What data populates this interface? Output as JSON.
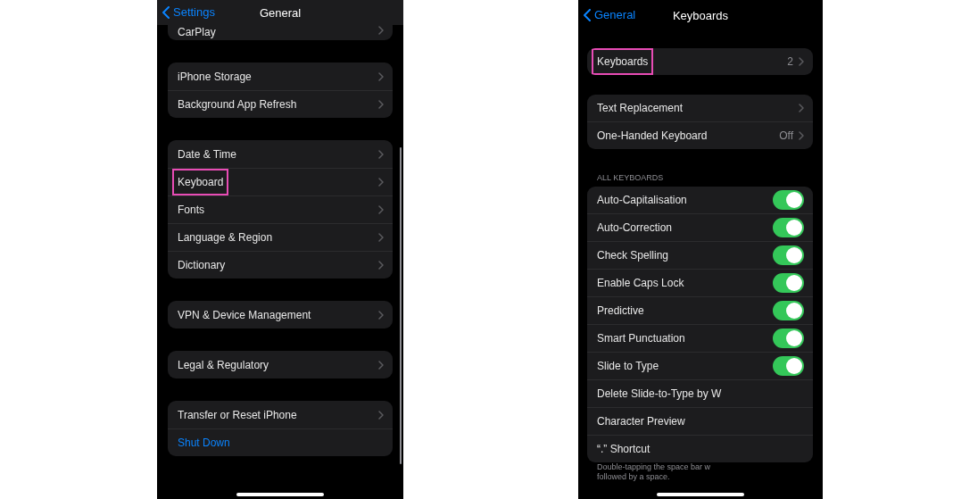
{
  "screens": [
    {
      "back": "Settings",
      "title": "General",
      "groups": [
        {
          "rows": [
            {
              "label": "CarPlay",
              "kind": "link"
            }
          ]
        },
        {
          "rows": [
            {
              "label": "iPhone Storage",
              "kind": "link"
            },
            {
              "label": "Background App Refresh",
              "kind": "link"
            }
          ]
        },
        {
          "rows": [
            {
              "label": "Date & Time",
              "kind": "link"
            },
            {
              "label": "Keyboard",
              "kind": "link",
              "highlighted": true
            },
            {
              "label": "Fonts",
              "kind": "link"
            },
            {
              "label": "Language & Region",
              "kind": "link"
            },
            {
              "label": "Dictionary",
              "kind": "link"
            }
          ]
        },
        {
          "rows": [
            {
              "label": "VPN & Device Management",
              "kind": "link"
            }
          ]
        },
        {
          "rows": [
            {
              "label": "Legal & Regulatory",
              "kind": "link"
            }
          ]
        },
        {
          "rows": [
            {
              "label": "Transfer or Reset iPhone",
              "kind": "link"
            },
            {
              "label": "Shut Down",
              "kind": "action"
            }
          ]
        }
      ]
    },
    {
      "back": "General",
      "title": "Keyboards",
      "groups": [
        {
          "rows": [
            {
              "label": "Keyboards",
              "kind": "link",
              "value": "2",
              "highlighted": true
            }
          ]
        },
        {
          "rows": [
            {
              "label": "Text Replacement",
              "kind": "link"
            },
            {
              "label": "One-Handed Keyboard",
              "kind": "link",
              "value": "Off"
            }
          ]
        },
        {
          "header": "ALL KEYBOARDS",
          "rows": [
            {
              "label": "Auto-Capitalisation",
              "kind": "toggle",
              "on": true
            },
            {
              "label": "Auto-Correction",
              "kind": "toggle",
              "on": true
            },
            {
              "label": "Check Spelling",
              "kind": "toggle",
              "on": true
            },
            {
              "label": "Enable Caps Lock",
              "kind": "toggle",
              "on": true
            },
            {
              "label": "Predictive",
              "kind": "toggle",
              "on": true
            },
            {
              "label": "Smart Punctuation",
              "kind": "toggle",
              "on": true
            },
            {
              "label": "Slide to Type",
              "kind": "toggle",
              "on": true
            },
            {
              "label": "Delete Slide-to-Type by W",
              "kind": "plain"
            },
            {
              "label": "Character Preview",
              "kind": "plain"
            },
            {
              "label": "“.” Shortcut",
              "kind": "plain"
            }
          ],
          "footer": [
            "Double-tapping the space bar w",
            "followed by a space."
          ]
        }
      ]
    }
  ]
}
